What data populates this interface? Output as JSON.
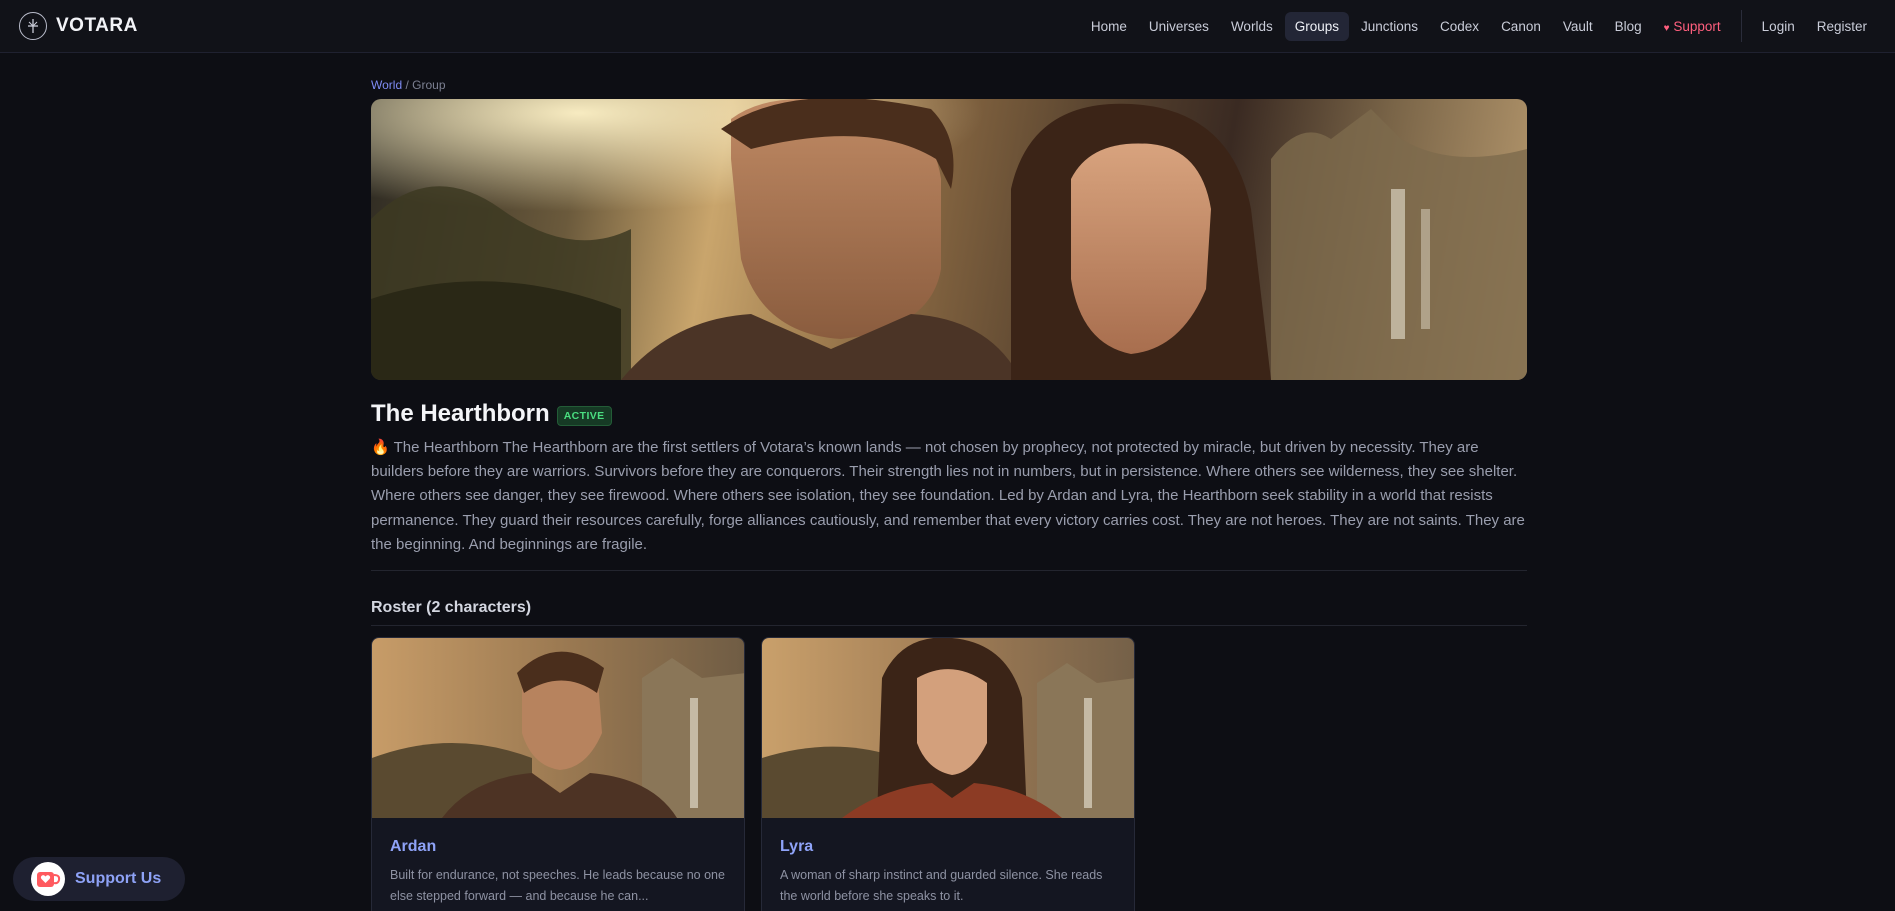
{
  "brand": {
    "name": "VOTARA",
    "logo_icon": "compass-icon"
  },
  "nav": {
    "items": [
      {
        "label": "Home",
        "active": false
      },
      {
        "label": "Universes",
        "active": false
      },
      {
        "label": "Worlds",
        "active": false
      },
      {
        "label": "Groups",
        "active": true
      },
      {
        "label": "Junctions",
        "active": false
      },
      {
        "label": "Codex",
        "active": false
      },
      {
        "label": "Canon",
        "active": false
      },
      {
        "label": "Vault",
        "active": false
      },
      {
        "label": "Blog",
        "active": false
      }
    ],
    "support_label": "Support",
    "support_icon": "heart-icon",
    "login_label": "Login",
    "register_label": "Register"
  },
  "breadcrumb": {
    "parent": "World",
    "separator": "/",
    "current": "Group"
  },
  "group": {
    "title": "The Hearthborn",
    "status": "ACTIVE",
    "description_icon": "fire-icon",
    "description": "🔥 The Hearthborn The Hearthborn are the first settlers of Votara’s known lands — not chosen by prophecy, not protected by miracle, but driven by necessity. They are builders before they are warriors. Survivors before they are conquerors. Their strength lies not in numbers, but in persistence. Where others see wilderness, they see shelter. Where others see danger, they see firewood. Where others see isolation, they see foundation. Led by Ardan and Lyra, the Hearthborn seek stability in a world that resists permanence. They guard their resources carefully, forge alliances cautiously, and remember that every victory carries cost. They are not heroes. They are not saints. They are the beginning. And beginnings are fragile."
  },
  "roster": {
    "title": "Roster (2 characters)",
    "characters": [
      {
        "name": "Ardan",
        "description": "Built for endurance, not speeches. He leads because no one else stepped forward — and because he can..."
      },
      {
        "name": "Lyra",
        "description": "A woman of sharp instinct and guarded silence. She reads the world before she speaks to it."
      }
    ]
  },
  "support_float": {
    "label": "Support Us",
    "icon": "coffee-cup-heart-icon"
  },
  "colors": {
    "background": "#0d0e14",
    "accent": "#8fa3f8",
    "support": "#ff5f7e",
    "active_badge": "#4ade80"
  }
}
